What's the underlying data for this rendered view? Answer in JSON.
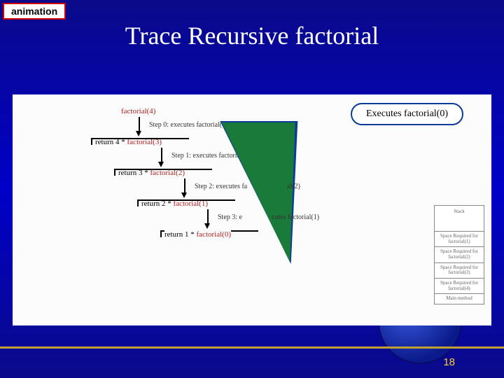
{
  "badge": "animation",
  "title": "Trace Recursive factorial",
  "callout": "Executes factorial(0)",
  "trace": {
    "call0": "factorial(4)",
    "step0": "Step 0: executes factorial(4)",
    "ret0a": "return 4 * ",
    "ret0b": "factorial(3)",
    "step1": "Step 1: executes factorial(3)",
    "ret1a": "return 3 * ",
    "ret1b": "factorial(2)",
    "step2a": "Step 2: executes fa",
    "step2b": "al(2)",
    "ret2a": "return 2 * ",
    "ret2b": "factorial(1)",
    "step3a": "Step 3: e",
    "step3b": "cutes factorial(1)",
    "ret3a": "return 1 * ",
    "ret3b": "factorial(0)"
  },
  "stack": {
    "header": "Stack",
    "cells": [
      "Space Required for factorial(1)",
      "Space Required for factorial(2)",
      "Space Required for factorial(3)",
      "Space Required for factorial(4)",
      "Main method"
    ]
  },
  "page": "18"
}
